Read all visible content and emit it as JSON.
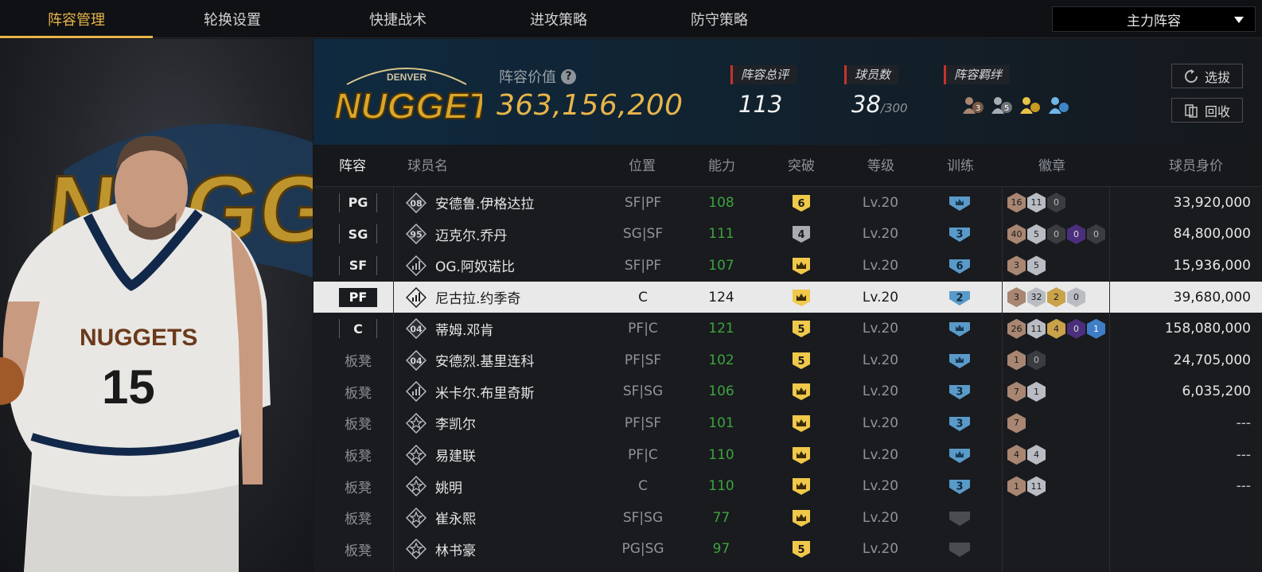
{
  "tabs": [
    {
      "label": "阵容管理",
      "active": true
    },
    {
      "label": "轮换设置",
      "active": false
    },
    {
      "label": "快捷战术",
      "active": false
    },
    {
      "label": "进攻策略",
      "active": false
    },
    {
      "label": "防守策略",
      "active": false
    }
  ],
  "lineup_select": "主力阵容",
  "team": {
    "logo_text": "NUGGETS",
    "logo_subtext": "DENVER",
    "value_label": "阵容价值",
    "value": "363,156,200"
  },
  "stats": {
    "rating_label": "阵容总评",
    "rating": "113",
    "players_label": "球员数",
    "players": "38",
    "players_max": "/300",
    "bonds_label": "阵容羁绊",
    "bond_counts": [
      "3",
      "5",
      "",
      ""
    ]
  },
  "buttons": {
    "select": "选拔",
    "recycle": "回收"
  },
  "hero": {
    "jersey_team": "NUGGETS",
    "jersey_number": "15",
    "bg_text": "NUGGETS"
  },
  "columns": [
    "阵容",
    "球员名",
    "位置",
    "能力",
    "突破",
    "等级",
    "训练",
    "徽章",
    "球员身价"
  ],
  "players": [
    {
      "slot": "PG",
      "starter": true,
      "icon": "08",
      "name": "安德鲁.伊格达拉",
      "pos": "SF|PF",
      "ability": "108",
      "breakthrough": "6",
      "level": "Lv.20",
      "training": "",
      "badges": [
        [
          "16",
          "bronze"
        ],
        [
          "11",
          "silver"
        ],
        [
          "0",
          "dark"
        ]
      ],
      "price": "33,920,000"
    },
    {
      "slot": "SG",
      "starter": true,
      "icon": "95",
      "name": "迈克尔.乔丹",
      "pos": "SG|SF",
      "ability": "111",
      "breakthrough": "4",
      "level": "Lv.20",
      "training": "3",
      "badges": [
        [
          "40",
          "bronze"
        ],
        [
          "5",
          "silver"
        ],
        [
          "0",
          "dark"
        ],
        [
          "0",
          "purple"
        ],
        [
          "0",
          "dark"
        ]
      ],
      "price": "84,800,000"
    },
    {
      "slot": "SF",
      "starter": true,
      "icon": "bars",
      "name": "OG.阿奴诺比",
      "pos": "SF|PF",
      "ability": "107",
      "breakthrough": "crown",
      "level": "Lv.20",
      "training": "6",
      "badges": [
        [
          "3",
          "bronze"
        ],
        [
          "5",
          "silver"
        ]
      ],
      "price": "15,936,000"
    },
    {
      "slot": "PF",
      "starter": true,
      "selected": true,
      "icon": "bars",
      "name": "尼古拉.约季奇",
      "pos": "C",
      "ability": "124",
      "breakthrough": "crown",
      "level": "Lv.20",
      "training": "2",
      "badges": [
        [
          "3",
          "bronze"
        ],
        [
          "32",
          "silver"
        ],
        [
          "2",
          "gold"
        ],
        [
          "0",
          "silver"
        ]
      ],
      "price": "39,680,000"
    },
    {
      "slot": "C",
      "starter": true,
      "icon": "04",
      "name": "蒂姆.邓肯",
      "pos": "PF|C",
      "ability": "121",
      "breakthrough": "5",
      "level": "Lv.20",
      "training": "",
      "badges": [
        [
          "26",
          "bronze"
        ],
        [
          "11",
          "silver"
        ],
        [
          "4",
          "gold"
        ],
        [
          "0",
          "purple"
        ],
        [
          "1",
          "blue"
        ]
      ],
      "price": "158,080,000"
    },
    {
      "slot": "板凳",
      "starter": false,
      "icon": "04",
      "name": "安德烈.基里连科",
      "pos": "PF|SF",
      "ability": "102",
      "breakthrough": "5",
      "level": "Lv.20",
      "training": "",
      "badges": [
        [
          "1",
          "bronze"
        ],
        [
          "0",
          "dark"
        ]
      ],
      "price": "24,705,000"
    },
    {
      "slot": "板凳",
      "starter": false,
      "icon": "bars",
      "name": "米卡尔.布里奇斯",
      "pos": "SF|SG",
      "ability": "106",
      "breakthrough": "crown",
      "level": "Lv.20",
      "training": "3",
      "badges": [
        [
          "7",
          "bronze"
        ],
        [
          "1",
          "silver"
        ]
      ],
      "price": "6,035,200"
    },
    {
      "slot": "板凳",
      "starter": false,
      "icon": "star",
      "name": "李凯尔",
      "pos": "PF|SF",
      "ability": "101",
      "breakthrough": "crown",
      "level": "Lv.20",
      "training": "3",
      "badges": [
        [
          "7",
          "bronze"
        ]
      ],
      "price": "---"
    },
    {
      "slot": "板凳",
      "starter": false,
      "icon": "star",
      "name": "易建联",
      "pos": "PF|C",
      "ability": "110",
      "breakthrough": "crown",
      "level": "Lv.20",
      "training": "",
      "badges": [
        [
          "4",
          "bronze"
        ],
        [
          "4",
          "silver"
        ]
      ],
      "price": "---"
    },
    {
      "slot": "板凳",
      "starter": false,
      "icon": "star",
      "name": "姚明",
      "pos": "C",
      "ability": "110",
      "breakthrough": "crown",
      "level": "Lv.20",
      "training": "3",
      "badges": [
        [
          "1",
          "bronze"
        ],
        [
          "11",
          "silver"
        ]
      ],
      "price": "---"
    },
    {
      "slot": "板凳",
      "starter": false,
      "icon": "star",
      "name": "崔永熙",
      "pos": "SF|SG",
      "ability": "77",
      "breakthrough": "crown",
      "level": "Lv.20",
      "training": "grey",
      "badges": [],
      "price": ""
    },
    {
      "slot": "板凳",
      "starter": false,
      "icon": "star",
      "name": "林书豪",
      "pos": "PG|SG",
      "ability": "97",
      "breakthrough": "5",
      "level": "Lv.20",
      "training": "grey",
      "badges": [],
      "price": ""
    }
  ],
  "colors": {
    "accent": "#e8b54a",
    "ability_green": "#3da23d",
    "stat_red": "#c8322a",
    "train_blue": "#5a9ac8"
  }
}
